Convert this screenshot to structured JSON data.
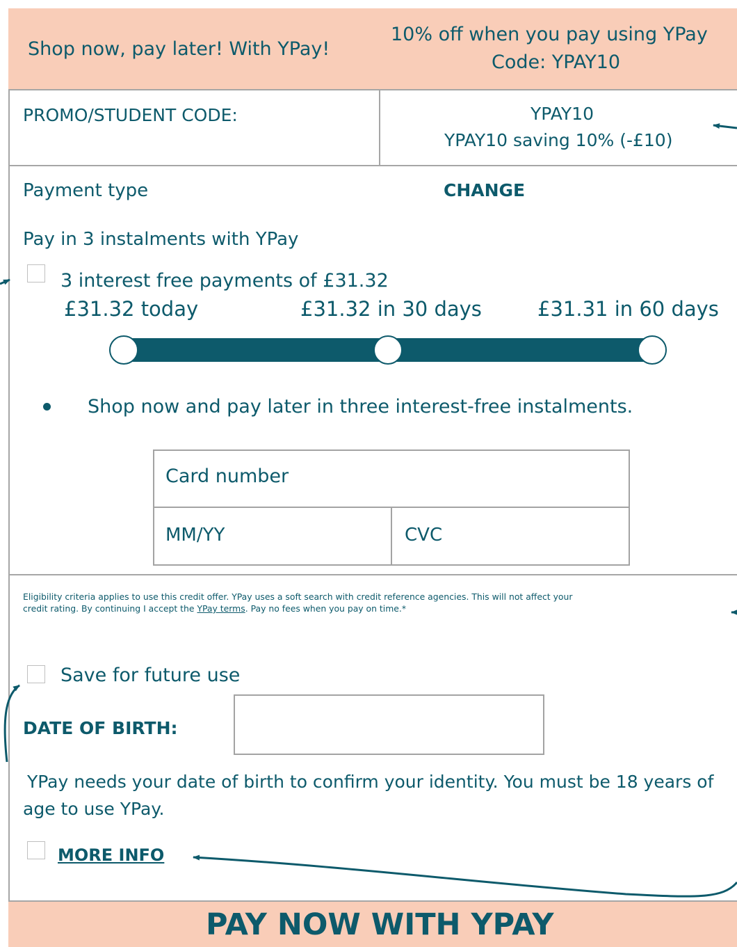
{
  "top_banner": {
    "left_text": "Shop now, pay later! With YPay!",
    "offer_line1": "10% off when you pay using YPay",
    "offer_line2": "Code: YPAY10"
  },
  "promo": {
    "label": "PROMO/STUDENT CODE:",
    "code": "YPAY10",
    "saving": "YPAY10 saving 10% (-£10)"
  },
  "payment": {
    "type_label": "Payment type",
    "change_label": "CHANGE",
    "method_title": "Pay in 3 instalments with YPay",
    "option_label": "3 interest free payments of £31.32",
    "schedule": [
      {
        "label": "£31.32 today"
      },
      {
        "label": "£31.32 in 30 days"
      },
      {
        "label": "£31.31 in 60 days"
      }
    ],
    "bullet": "Shop now and pay later in three interest-free instalments."
  },
  "card": {
    "number_placeholder": "Card number",
    "expiry_placeholder": "MM/YY",
    "cvc_placeholder": "CVC"
  },
  "legal": {
    "line1": "Eligibility criteria applies to use this credit offer. YPay uses a soft search with credit reference agencies. This will not affect your",
    "line2_pre": "credit rating. By continuing I accept the ",
    "terms_link": "YPay terms",
    "line2_post": ". Pay no fees when you pay on time.*"
  },
  "save_future_label": "Save for future use",
  "dob": {
    "label": "DATE OF BIRTH:",
    "value": "",
    "help_line1": " YPay needs your date of birth to confirm your identity. You must be 18 years of",
    "help_line2": "age to use YPay."
  },
  "more_info_label": "MORE INFO",
  "pay_button_label": "PAY NOW WITH YPAY",
  "colors": {
    "accent": "#0d5a6b",
    "banner": "#f9cdb8",
    "border": "#a6a6a6"
  }
}
